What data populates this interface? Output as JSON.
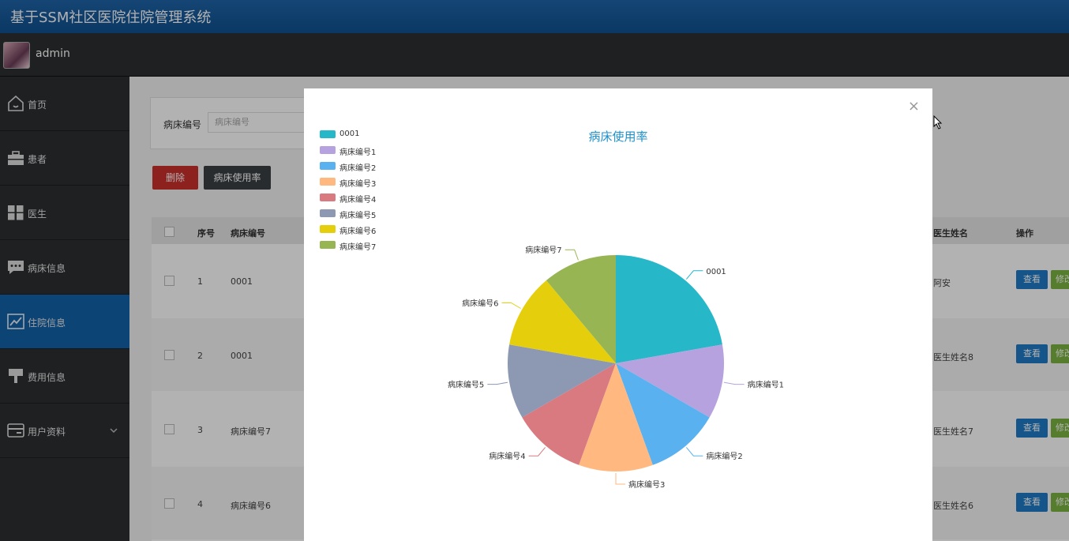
{
  "app": {
    "title": "基于SSM社区医院住院管理系统",
    "username": "admin"
  },
  "sidebar": {
    "items": [
      {
        "label": "首页",
        "icon": "home-icon"
      },
      {
        "label": "患者",
        "icon": "briefcase-icon"
      },
      {
        "label": "医生",
        "icon": "grid-icon"
      },
      {
        "label": "病床信息",
        "icon": "chat-icon"
      },
      {
        "label": "住院信息",
        "icon": "trend-icon",
        "active": true
      },
      {
        "label": "费用信息",
        "icon": "brush-icon"
      },
      {
        "label": "用户资料",
        "icon": "card-icon",
        "expandable": true
      }
    ]
  },
  "search": {
    "label": "病床编号",
    "placeholder": "病床编号"
  },
  "toolbar": {
    "delete_label": "删除",
    "rate_label": "病床使用率"
  },
  "table": {
    "headers": {
      "seq": "序号",
      "bed": "病床编号",
      "doctor": "医生姓名",
      "action": "操作"
    },
    "rows": [
      {
        "seq": "1",
        "bed": "0001",
        "doctor": "阿安"
      },
      {
        "seq": "2",
        "bed": "0001",
        "doctor": "医生姓名8"
      },
      {
        "seq": "3",
        "bed": "病床编号7",
        "doctor": "医生姓名7"
      },
      {
        "seq": "4",
        "bed": "病床编号6",
        "doctor": "医生姓名6"
      }
    ],
    "view_label": "查看",
    "edit_label": "修改"
  },
  "modal": {
    "close_symbol": "×"
  },
  "chart_data": {
    "type": "pie",
    "title": "病床使用率",
    "legend_position": "top-left",
    "slices": [
      {
        "name": "0001",
        "value": 2,
        "color": "#26b7c9"
      },
      {
        "name": "病床编号1",
        "value": 1,
        "color": "#b6a2de"
      },
      {
        "name": "病床编号2",
        "value": 1,
        "color": "#5ab1ef"
      },
      {
        "name": "病床编号3",
        "value": 1,
        "color": "#ffb980"
      },
      {
        "name": "病床编号4",
        "value": 1,
        "color": "#d87a80"
      },
      {
        "name": "病床编号5",
        "value": 1,
        "color": "#8d98b3"
      },
      {
        "name": "病床编号6",
        "value": 1,
        "color": "#e5cf0d"
      },
      {
        "name": "病床编号7",
        "value": 1,
        "color": "#97b552"
      }
    ]
  }
}
